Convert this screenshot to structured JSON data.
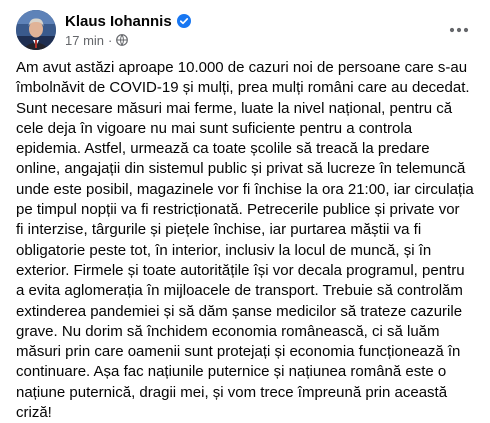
{
  "post": {
    "author": {
      "name": "Klaus Iohannis",
      "verified_icon": "verified-badge-icon",
      "verified_color": "#1877f2"
    },
    "meta": {
      "time": "17 min",
      "separator": "·",
      "audience_icon": "globe-icon"
    },
    "more_icon": "more-options-icon",
    "text": "Am avut astăzi aproape 10.000 de cazuri noi de persoane care s-au\nîmbolnăvit de COVID-19 și mulți, prea mulți români care au decedat.\nSunt necesare măsuri mai ferme, luate la nivel național, pentru că\ncele deja în vigoare nu mai sunt suficiente pentru a controla\nepidemia. Astfel, urmează ca toate școlile să treacă la predare\nonline, angajații din sistemul public și privat să lucreze în telemuncă\nunde este posibil, magazinele vor fi închise la ora 21:00, iar circulația\npe timpul nopții va fi restricționată. Petrecerile publice și private vor\nfi interzise, târgurile și piețele închise, iar purtarea măștii va fi\nobligatorie peste tot, în interior, inclusiv la locul de muncă, și în\nexterior. Firmele și toate autoritățile își vor decala programul, pentru\na evita aglomerația în mijloacele de transport. Trebuie să controlăm\nextinderea pandemiei și să dăm șanse medicilor să trateze cazurile\ngrave. Nu dorim să închidem economia românească, ci să luăm\nmăsuri prin care oamenii sunt protejați și economia funcționează în\ncontinuare. Așa fac națiunile puternice și națiunea română este o\nnațiune puternică, dragii mei, și vom trece împreună prin această\ncriză!"
  }
}
